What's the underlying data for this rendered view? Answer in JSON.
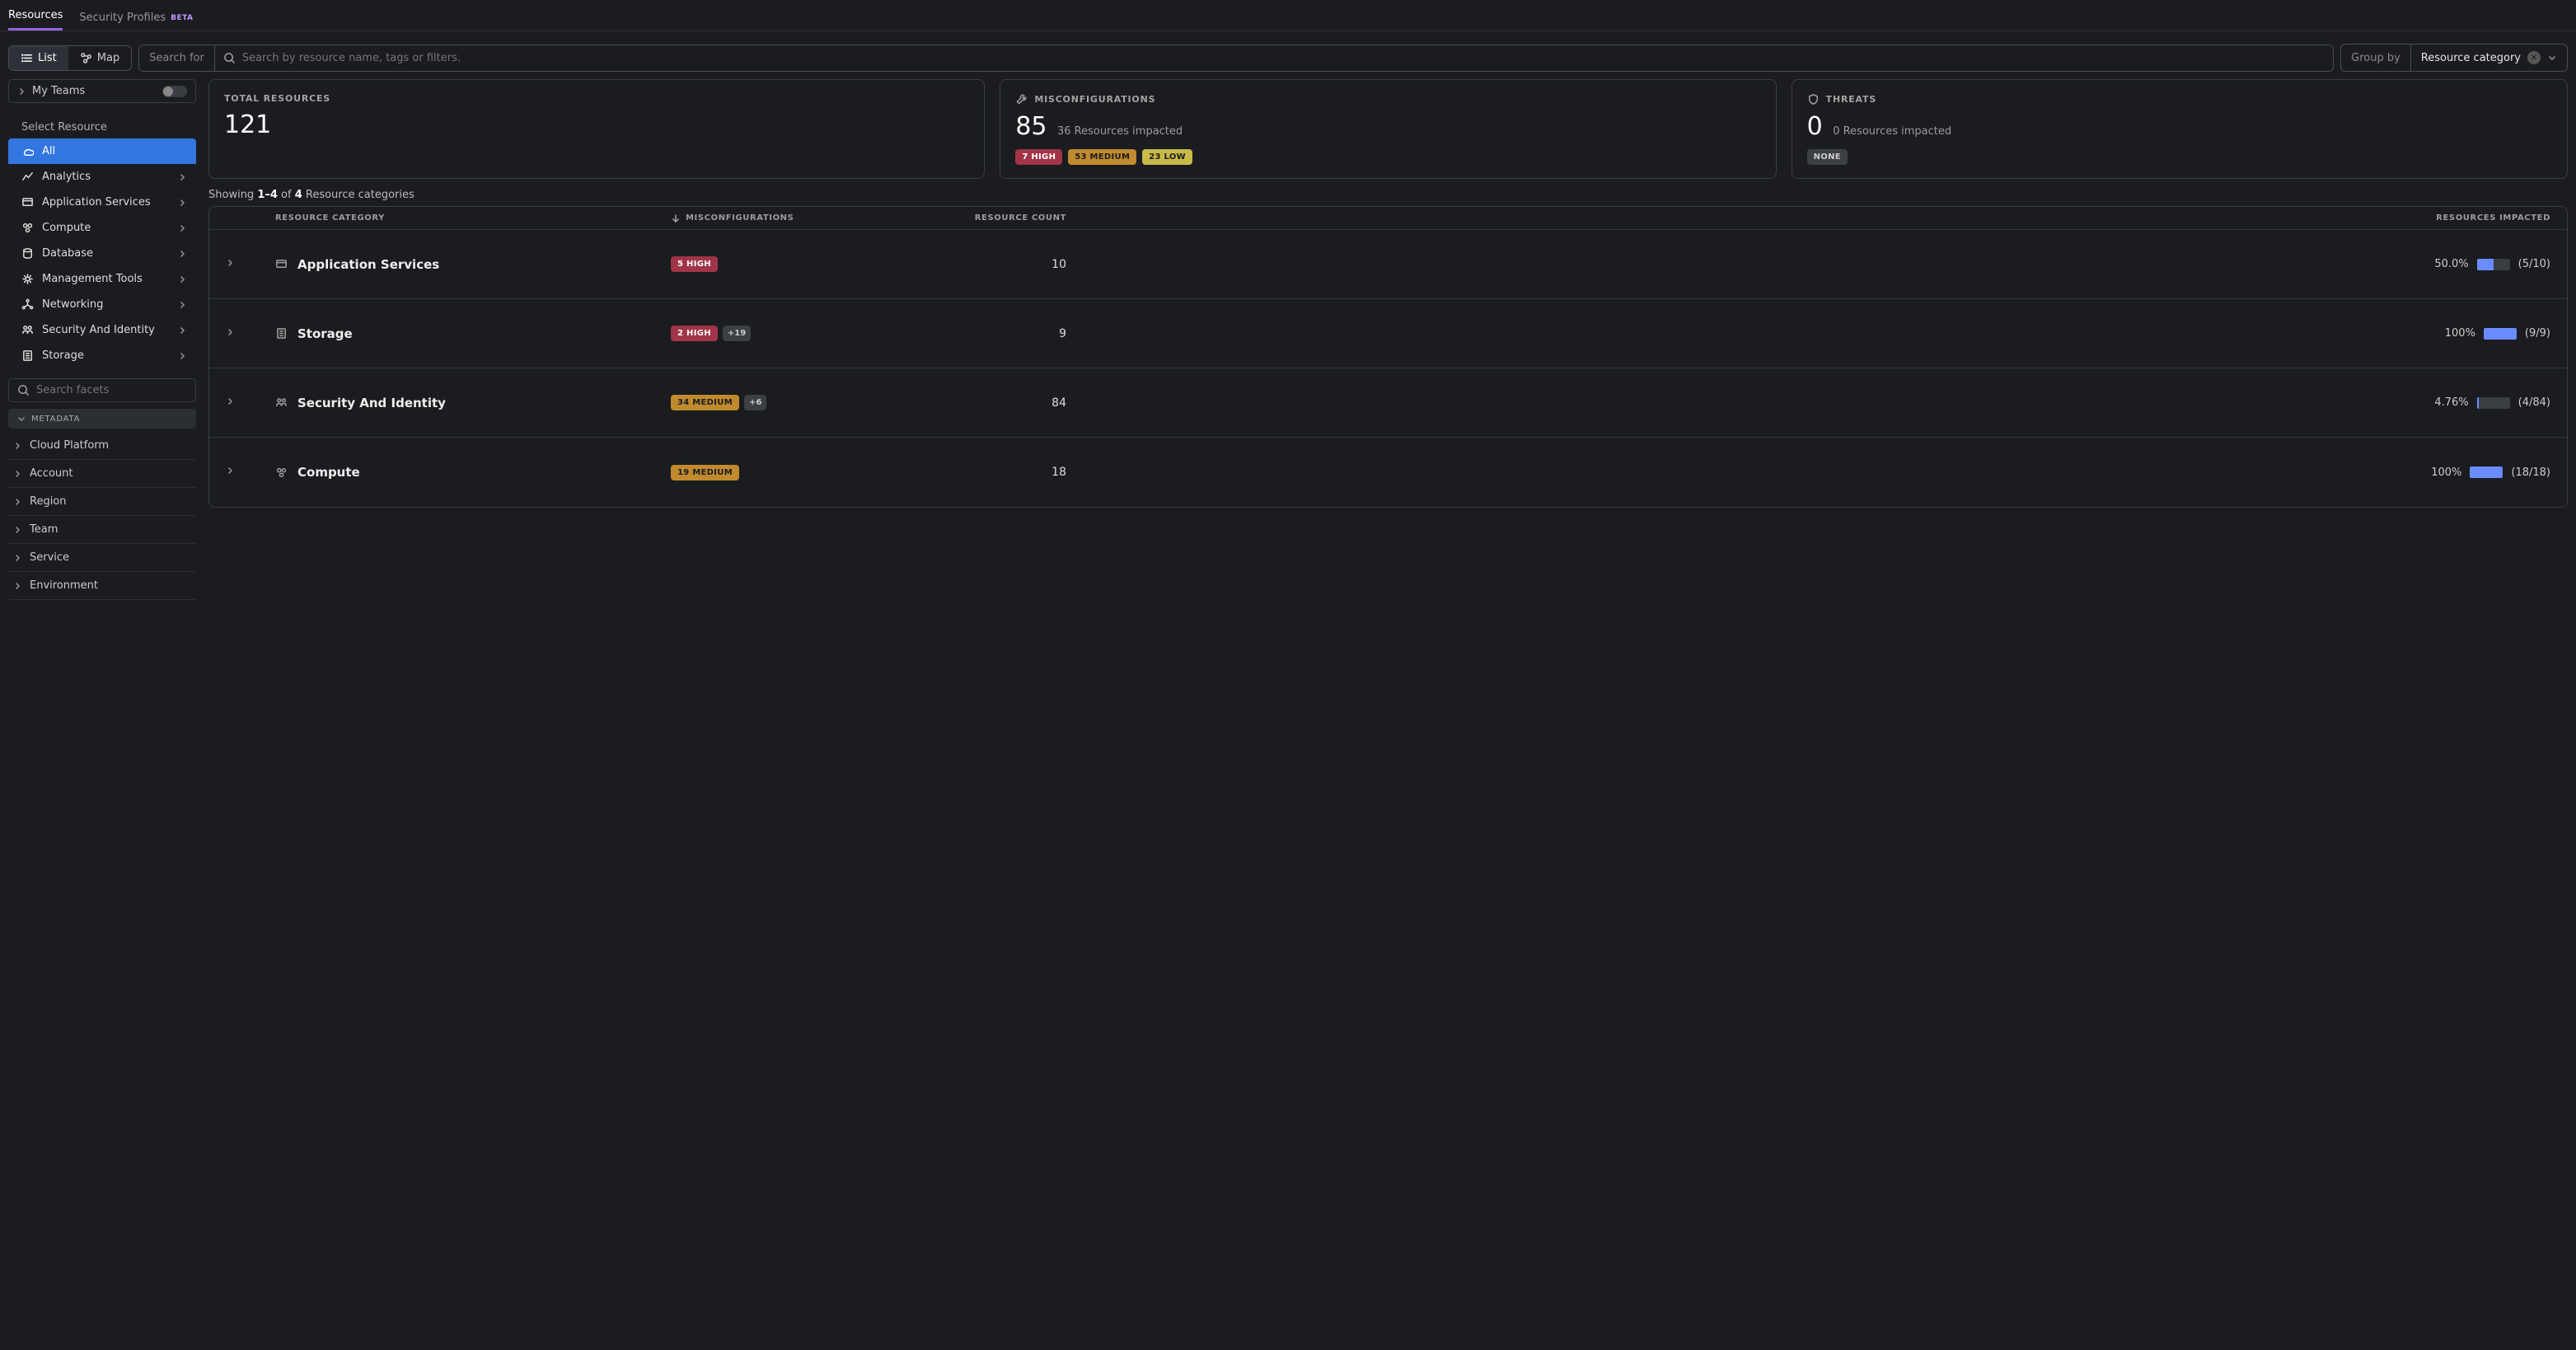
{
  "tabs": {
    "resources": "Resources",
    "security": "Security Profiles",
    "beta": "BETA"
  },
  "toolbar": {
    "list": "List",
    "map": "Map",
    "search_for": "Search for",
    "search_ph": "Search by resource name, tags or filters.",
    "group_by": "Group by",
    "group_value": "Resource category"
  },
  "sidebar": {
    "my_teams": "My Teams",
    "select_resource": "Select Resource",
    "items": [
      {
        "label": "All"
      },
      {
        "label": "Analytics"
      },
      {
        "label": "Application Services"
      },
      {
        "label": "Compute"
      },
      {
        "label": "Database"
      },
      {
        "label": "Management Tools"
      },
      {
        "label": "Networking"
      },
      {
        "label": "Security And Identity"
      },
      {
        "label": "Storage"
      }
    ],
    "facet_search_ph": "Search facets",
    "metadata": "METADATA",
    "facets": [
      {
        "label": "Cloud Platform"
      },
      {
        "label": "Account"
      },
      {
        "label": "Region"
      },
      {
        "label": "Team"
      },
      {
        "label": "Service"
      },
      {
        "label": "Environment"
      }
    ]
  },
  "cards": {
    "total": {
      "title": "TOTAL RESOURCES",
      "value": "121"
    },
    "mis": {
      "title": "MISCONFIGURATIONS",
      "value": "85",
      "sub": "36 Resources impacted",
      "high": "7 HIGH",
      "med": "53 MEDIUM",
      "low": "23 LOW"
    },
    "threats": {
      "title": "THREATS",
      "value": "0",
      "sub": "0 Resources impacted",
      "none": "NONE"
    }
  },
  "showing": {
    "prefix": "Showing ",
    "range": "1–4",
    "of": " of ",
    "total": "4",
    "suffix": " Resource categories"
  },
  "table": {
    "headers": {
      "cat": "RESOURCE CATEGORY",
      "mis": "MISCONFIGURATIONS",
      "cnt": "RESOURCE COUNT",
      "imp": "RESOURCES IMPACTED"
    },
    "rows": [
      {
        "category": "Application Services",
        "badge": "5 HIGH",
        "badge_class": "b-high",
        "extra": "",
        "count": "10",
        "pct": "50.0%",
        "fill": 50,
        "frac": "(5/10)"
      },
      {
        "category": "Storage",
        "badge": "2 HIGH",
        "badge_class": "b-high",
        "extra": "+19",
        "count": "9",
        "pct": "100%",
        "fill": 100,
        "frac": "(9/9)"
      },
      {
        "category": "Security And Identity",
        "badge": "34 MEDIUM",
        "badge_class": "b-med",
        "extra": "+6",
        "count": "84",
        "pct": "4.76%",
        "fill": 4.76,
        "frac": "(4/84)"
      },
      {
        "category": "Compute",
        "badge": "19 MEDIUM",
        "badge_class": "b-med",
        "extra": "",
        "count": "18",
        "pct": "100%",
        "fill": 100,
        "frac": "(18/18)"
      }
    ]
  }
}
